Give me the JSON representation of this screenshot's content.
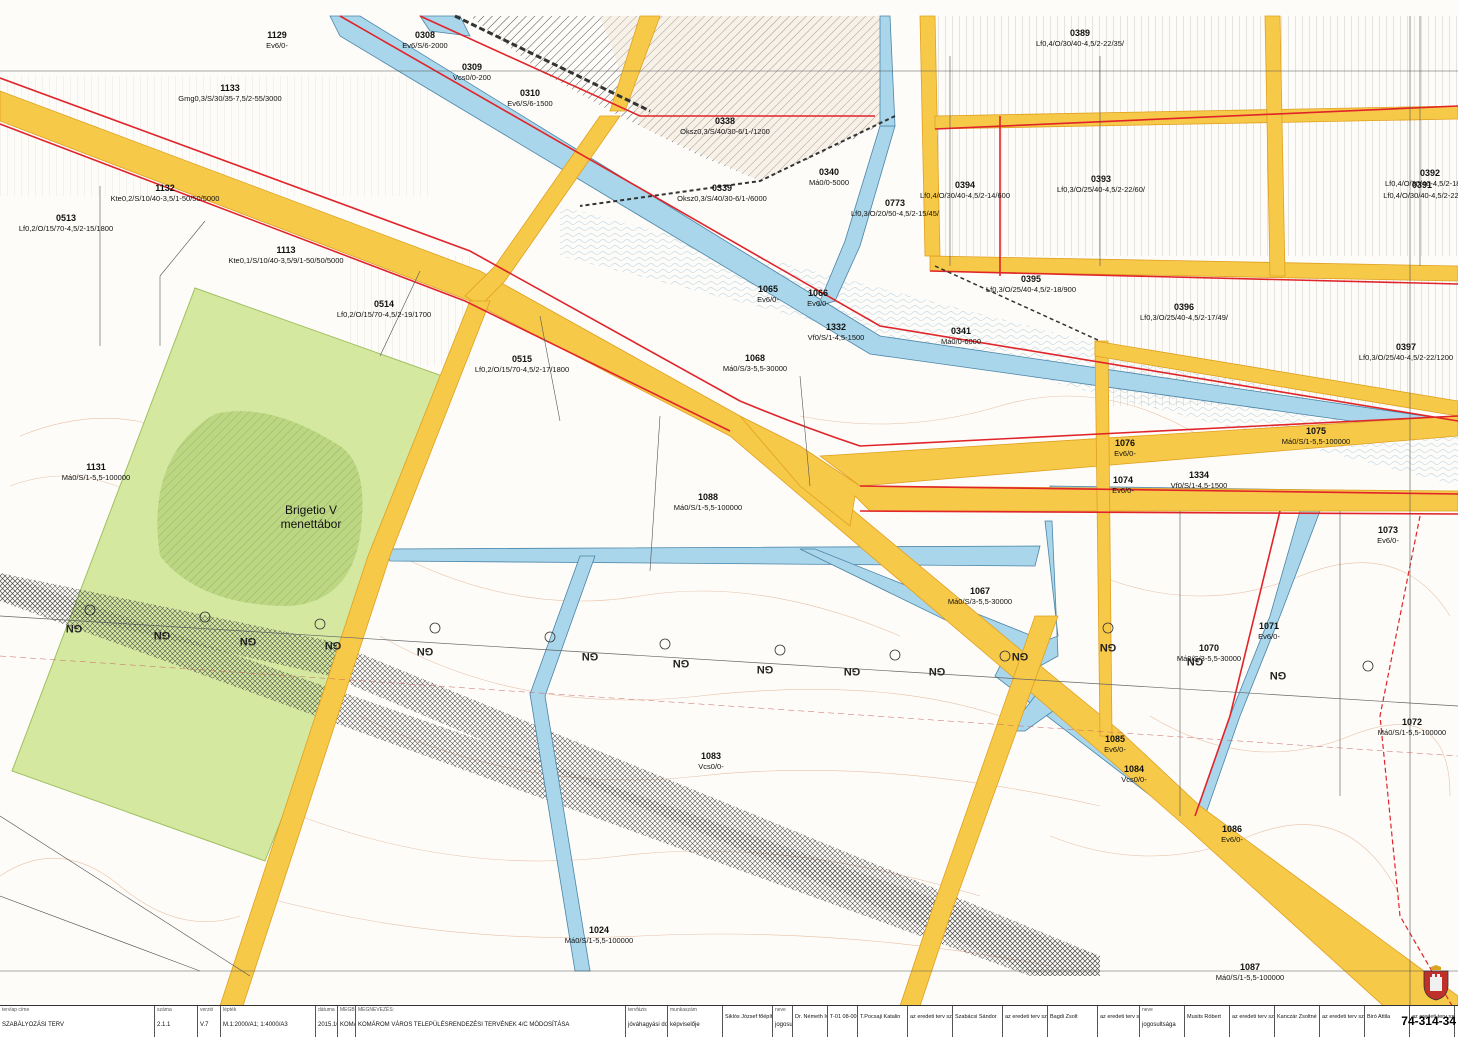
{
  "map": {
    "parcels": [
      {
        "id": "1129",
        "code": "Ev6/0-"
      },
      {
        "id": "0308",
        "code": "Ev6/S/6-2000"
      },
      {
        "id": "0309",
        "code": "Vcs0/0-200"
      },
      {
        "id": "0310",
        "code": "Ev6/S/6-1500"
      },
      {
        "id": "1133",
        "code": "Gmg0,3/S/30/35-7,5/2-55/3000"
      },
      {
        "id": "0338",
        "code": "Oksz0,3/S/40/30-6/1-/1200"
      },
      {
        "id": "0389",
        "code": "Lf0,4/O/30/40-4,5/2-22/35/"
      },
      {
        "id": "0340",
        "code": "Má0/0-5000"
      },
      {
        "id": "0339",
        "code": "Oksz0,3/S/40/30-6/1-/6000"
      },
      {
        "id": "0773",
        "code": "Lf0,3/O/20/50-4,5/2-15/45/"
      },
      {
        "id": "0394",
        "code": "Lf0,4/O/30/40-4,5/2-14/600"
      },
      {
        "id": "0393",
        "code": "Lf0,3/O/25/40-4,5/2-22/60/"
      },
      {
        "id": "0392",
        "code": "Lf0,4/O/30/40-4,5/2-18/700"
      },
      {
        "id": "0391",
        "code": "Lf0,4/O/30/40-4,5/2-22/"
      },
      {
        "id": "1132",
        "code": "Kte0,2/S/10/40-3,5/1-50/50/5000"
      },
      {
        "id": "0513",
        "code": "Lf0,2/O/15/70-4,5/2-15/1800"
      },
      {
        "id": "1113",
        "code": "Kte0,1/S/10/40-3,5/9/1-50/50/5000"
      },
      {
        "id": "0395",
        "code": "Lf0,3/O/25/40-4,5/2-18/900"
      },
      {
        "id": "0396",
        "code": "Lf0,3/O/25/40-4,5/2-17/49/"
      },
      {
        "id": "1065",
        "code": "Ev6/0-"
      },
      {
        "id": "1066",
        "code": "Ev6/0-"
      },
      {
        "id": "1332",
        "code": "Vf0/S/1-4,5-1500"
      },
      {
        "id": "0341",
        "code": "Má0/0-6000"
      },
      {
        "id": "0514",
        "code": "Lf0,2/O/15/70-4,5/2-19/1700"
      },
      {
        "id": "0515",
        "code": "Lf0,2/O/15/70-4,5/2-17/1800"
      },
      {
        "id": "0397",
        "code": "Lf0,3/O/25/40-4,5/2-22/1200"
      },
      {
        "id": "1068",
        "code": "Má0/S/3-5,5-30000"
      },
      {
        "id": "1075",
        "code": "Má0/S/1-5,5-100000"
      },
      {
        "id": "1076",
        "code": "Ev6/0-"
      },
      {
        "id": "1334",
        "code": "Vf0/S/1-4,5-1500"
      },
      {
        "id": "1074",
        "code": "Ev6/0-"
      },
      {
        "id": "1131",
        "code": "Má0/S/1-5,5-100000"
      },
      {
        "id": "1088",
        "code": "Má0/S/1-5,5-100000"
      },
      {
        "id": "1073",
        "code": "Ev6/0-"
      },
      {
        "id": "1067",
        "code": "Má0/S/3-5,5-30000"
      },
      {
        "id": "1071",
        "code": "Ev6/0-"
      },
      {
        "id": "1070",
        "code": "Má0/S/3-5,5-30000"
      },
      {
        "id": "1072",
        "code": "Má0/S/1-5,5-100000"
      },
      {
        "id": "1083",
        "code": "Vcs0/0-"
      },
      {
        "id": "1085",
        "code": "Ev6/0-"
      },
      {
        "id": "1084",
        "code": "Vcs0/0-"
      },
      {
        "id": "1086",
        "code": "Ev6/0-"
      },
      {
        "id": "1024",
        "code": "Má0/S/1-5,5-100000"
      },
      {
        "id": "1087",
        "code": "Má0/S/1-5,5-100000"
      }
    ],
    "area_label": [
      "Brigetio V",
      "menettábor"
    ],
    "gn_label": "GN",
    "gn_markers": [
      "GN",
      "GN",
      "GN",
      "GN",
      "GN",
      "GN",
      "GN",
      "GN",
      "GN",
      "GN",
      "GN",
      "GN",
      "GN",
      "GN"
    ],
    "colors": {
      "road": "#f7c948",
      "road_edge": "#e0a020",
      "water": "#a9d6ea",
      "water_edge": "#4a84a8",
      "green_area": "#d4e8a0",
      "green_core": "#b5d27a",
      "regulation_line": "#e0242a",
      "parcel_line": "#555555",
      "contour": "#d9a582",
      "hatch": "#555555"
    }
  },
  "titleblock": {
    "cells": [
      {
        "key": "tervlap címe",
        "value": "SZABÁLYOZÁSI TERV"
      },
      {
        "key": "száma",
        "value": "2.1.1"
      },
      {
        "key": "verzió",
        "value": "V.7"
      },
      {
        "key": "lépték",
        "value": "M.1:2000/A1; 1:4000/A3"
      },
      {
        "key": "dátuma",
        "value": "2015.10.15."
      },
      {
        "key": "MEGBÍZÓ:",
        "value": "KOMÁROM VÁROS ÖNKORMÁNYZATA"
      },
      {
        "key": "MEGNEVEZÉS:",
        "value": "KOMÁROM VÁROS TELEPÜLÉSRENDEZÉSI TERVÉNEK 4/C MÓDOSÍTÁSA"
      },
      {
        "key": "tervfázis",
        "value": "jóváhagyási dokumentáció"
      },
      {
        "key": "munkaszám",
        "value": "képviselője"
      },
      {
        "key": "",
        "value": "Siklós József főépítész"
      },
      {
        "key": "neve",
        "value": "jogosultsága"
      },
      {
        "key": "",
        "value": "Dr. Németh Iván"
      },
      {
        "key": "",
        "value": "T-01 08-0067"
      },
      {
        "key": "",
        "value": "T.Pocsaji Katalin"
      },
      {
        "key": "",
        "value": "az eredeti terv szakági tervezője"
      },
      {
        "key": "",
        "value": "Szabácsi Sándor"
      },
      {
        "key": "",
        "value": "az eredeti terv szakági tervezője"
      },
      {
        "key": "",
        "value": "Bagdi Zsolt"
      },
      {
        "key": "",
        "value": "az eredeti terv szakági tervezője"
      },
      {
        "key": "neve",
        "value": "jogosultsága"
      },
      {
        "key": "",
        "value": "Musits Róbert"
      },
      {
        "key": "",
        "value": "az eredeti terv szakági tervezője"
      },
      {
        "key": "",
        "value": "Kanczár Zsoltné"
      },
      {
        "key": "",
        "value": "az eredeti terv szakági tervezője"
      },
      {
        "key": "",
        "value": "Biró Attila"
      },
      {
        "key": "",
        "value": "az eredeti terv szakági tervezője"
      }
    ],
    "sheet_code": "74-314-34"
  }
}
